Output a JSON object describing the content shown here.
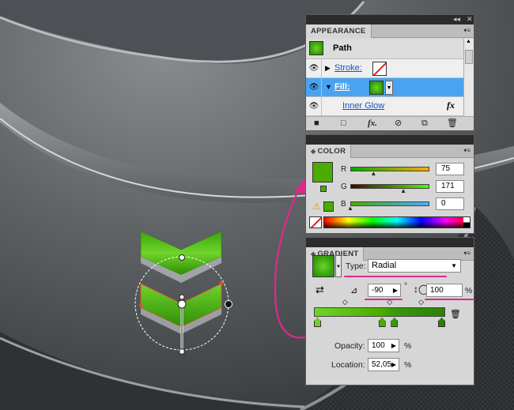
{
  "appearance": {
    "tab_label": "APPEARANCE",
    "path_label": "Path",
    "stroke_label": "Stroke:",
    "fill_label": "Fill:",
    "effect_label": "Inner Glow",
    "fx_glyph": "fx",
    "toolbar_icons": [
      "clear-icon",
      "new-art-basic-icon",
      "add-effect-icon",
      "clear-appearance-icon",
      "duplicate-item-icon",
      "delete-item-icon"
    ]
  },
  "color": {
    "tab_label": "COLOR",
    "channels": [
      {
        "label": "R",
        "value": "75",
        "fraction": 0.294
      },
      {
        "label": "G",
        "value": "171",
        "fraction": 0.671
      },
      {
        "label": "B",
        "value": "0",
        "fraction": 0.0
      }
    ],
    "current_color": "#4bab00"
  },
  "gradient": {
    "tab_label": "GRADIENT",
    "type_label": "Type:",
    "type_value": "Radial",
    "angle_value": "-90",
    "degree_symbol": "°",
    "aspect_value": "100",
    "percent_symbol": "%",
    "opacity_label": "Opacity:",
    "opacity_value": "100",
    "location_label": "Location:",
    "location_value": "52,05",
    "stops": [
      {
        "location": 0.0,
        "color": "#6fd42a"
      },
      {
        "location": 0.52,
        "color": "#4bab00"
      },
      {
        "location": 0.62,
        "color": "#3a9a08"
      },
      {
        "location": 1.0,
        "color": "#2a8006"
      }
    ],
    "midpoints": [
      0.24,
      0.58,
      0.82
    ]
  },
  "colors": {
    "accent_pink": "#e0288c",
    "selection_blue": "#4aa3f0",
    "panel_bg": "#d6d6d6",
    "green_light": "#6fd42a",
    "green_dark": "#2a8006"
  }
}
